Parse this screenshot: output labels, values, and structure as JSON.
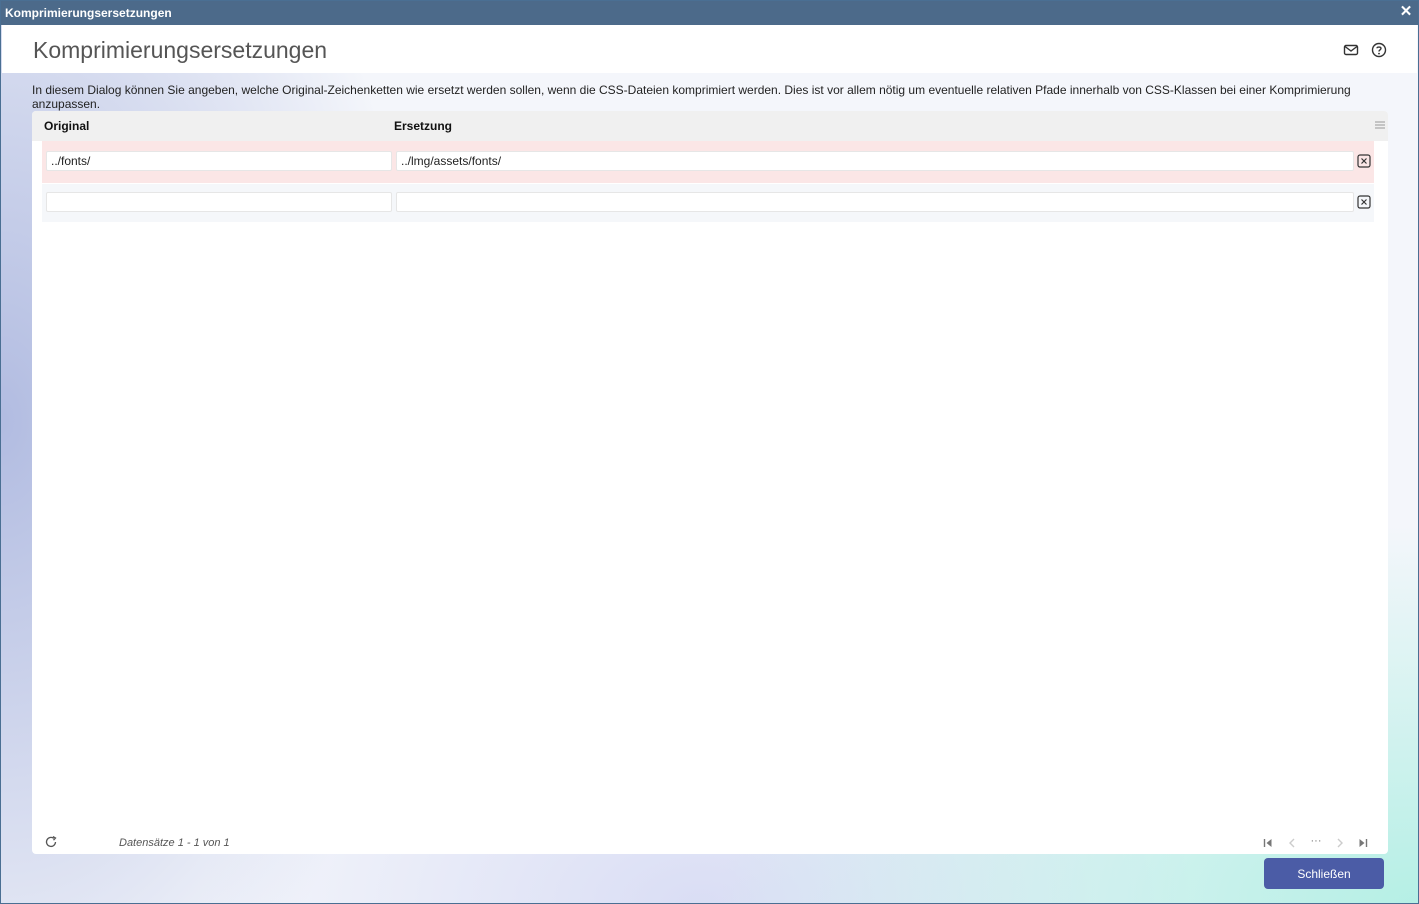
{
  "window": {
    "title": "Komprimierungsersetzungen",
    "close_glyph": "✕"
  },
  "header": {
    "heading": "Komprimierungsersetzungen",
    "icons": [
      "mail-icon",
      "help-icon"
    ]
  },
  "description": "In diesem Dialog können Sie angeben, welche Original-Zeichenketten wie ersetzt werden sollen, wenn die CSS-Dateien komprimiert werden. Dies ist vor allem nötig um eventuelle relativen Pfade innerhalb von CSS-Klassen bei einer Komprimierung anzupassen.",
  "grid": {
    "columns": {
      "original": "Original",
      "replacement": "Ersetzung"
    },
    "rows": [
      {
        "original": "../fonts/",
        "replacement": "../lmg/assets/fonts/"
      },
      {
        "original": "",
        "replacement": ""
      }
    ],
    "footer": {
      "records": "Datensätze 1 - 1 von 1",
      "pager_ellipsis": "···"
    }
  },
  "buttons": {
    "close": "Schließen"
  },
  "colors": {
    "titlebar": "#4c6a8a",
    "primary_button": "#4b5ca6",
    "row_highlight": "#fbe6e6"
  }
}
